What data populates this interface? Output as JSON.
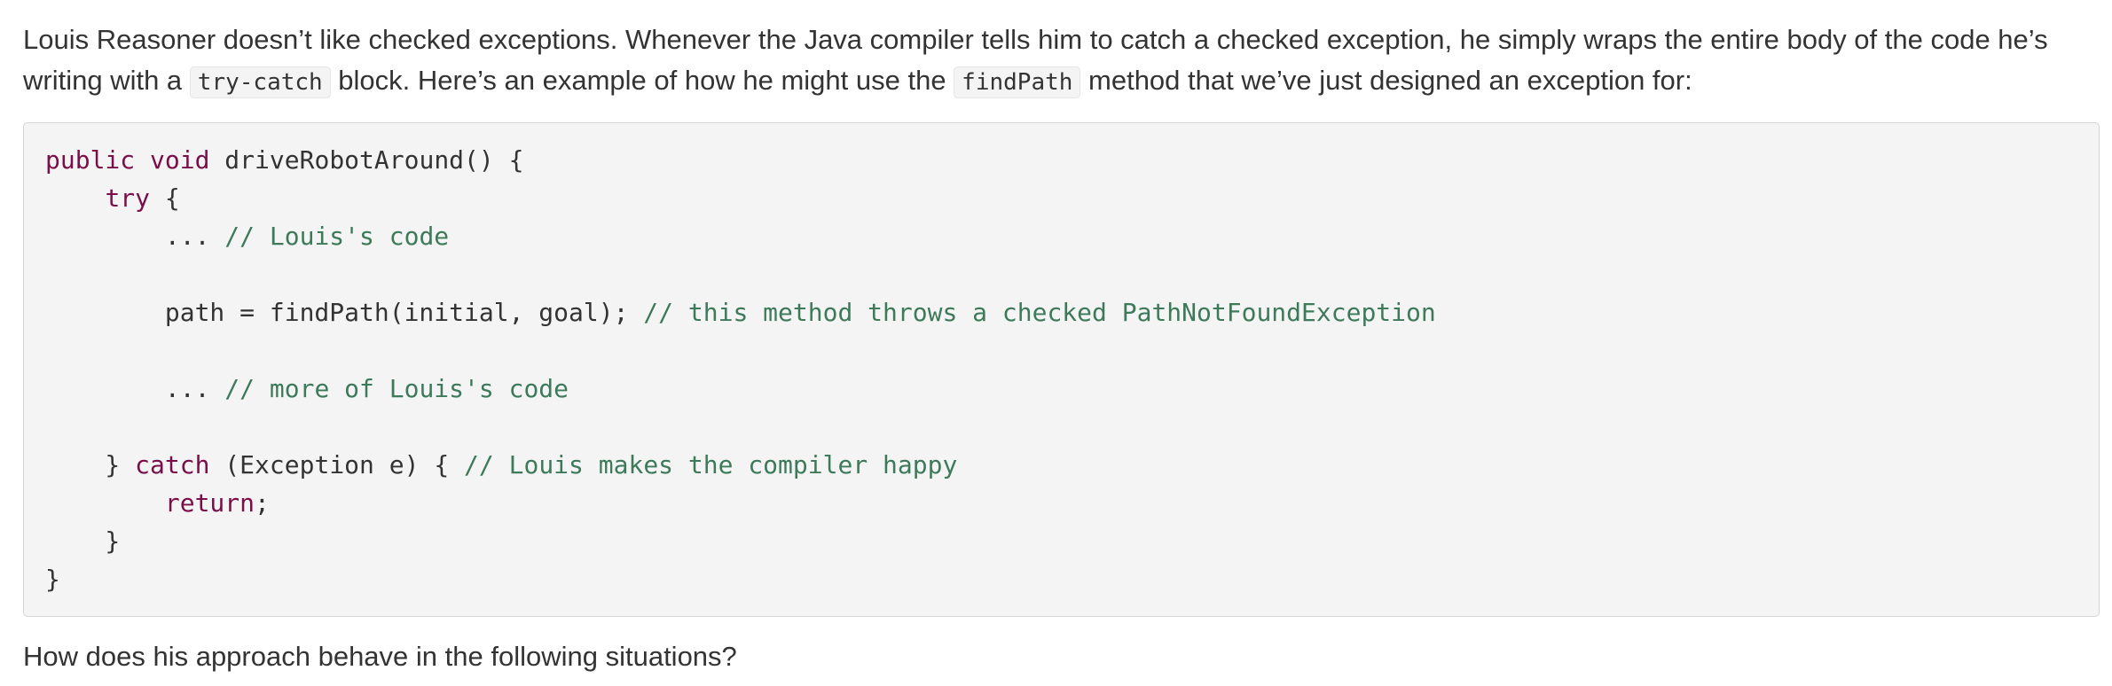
{
  "intro": {
    "text_1": "Louis Reasoner doesn’t like checked exceptions. Whenever the Java compiler tells him to catch a checked exception, he simply wraps the entire body of the code he’s writing with a ",
    "code_1": "try-catch",
    "text_2": " block. Here’s an example of how he might use the ",
    "code_2": "findPath",
    "text_3": " method that we’ve just designed an exception for:"
  },
  "code": {
    "l1_kw1": "public",
    "l1_kw2": "void",
    "l1_rest": " driveRobotAround() {",
    "l2_indent": "    ",
    "l2_kw": "try",
    "l2_rest": " {",
    "l3_code": "        ... ",
    "l3_comment": "// Louis's code",
    "l5_code": "        path = findPath(initial, goal); ",
    "l5_comment": "// this method throws a checked PathNotFoundException",
    "l7_code": "        ... ",
    "l7_comment": "// more of Louis's code",
    "l9_pre": "    } ",
    "l9_kw": "catch",
    "l9_mid": " (Exception e) { ",
    "l9_comment": "// Louis makes the compiler happy",
    "l10_indent": "        ",
    "l10_kw": "return",
    "l10_rest": ";",
    "l11": "    }",
    "l12": "}"
  },
  "question": "How does his approach behave in the following situations?"
}
